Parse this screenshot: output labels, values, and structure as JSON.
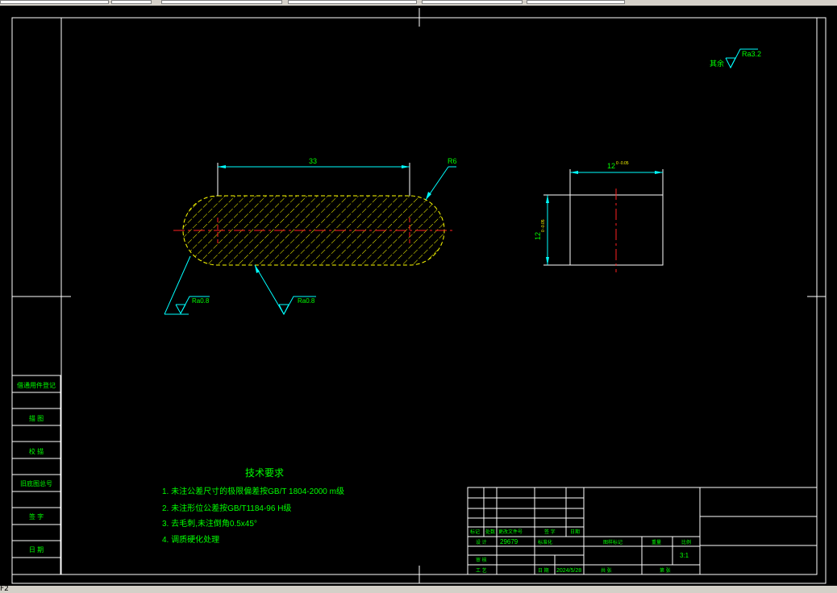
{
  "status_text": "F2",
  "drawing": {
    "surface_finish_general": {
      "prefix": "其余",
      "value": "Ra3.2"
    },
    "dim_length": "33",
    "dim_radius": "R6",
    "dim_width": "12",
    "dim_width_tol": "0\n-0.05",
    "dim_height": "12",
    "dim_height_tol": "0\n-0.05",
    "roughness_left": "Ra0.8",
    "roughness_bottom": "Ra0.8",
    "tech_title": "技术要求",
    "tech_notes": [
      "1. 未注公差尺寸的极限偏差按GB/T 1804-2000 m级",
      "2. 未注形位公差按GB/T1184-96 H级",
      "3. 去毛刺,未注倒角0.5x45°",
      "4. 调质硬化处理"
    ]
  },
  "side_column": [
    "借通用件登记",
    "描 图",
    "校 描",
    "旧底图总号",
    "签 字",
    "日 期"
  ],
  "title_block": {
    "row_labels": [
      "标记",
      "处数",
      "更改文件号",
      "签 字",
      "日期"
    ],
    "design_label": "设 计",
    "design_value": "29679",
    "std_label": "标准化",
    "review_label": "审 核",
    "process_label": "工 艺",
    "date_label": "日 期",
    "date_value": "2024/5/28",
    "stage_label": "图样标记",
    "weight_label": "重量",
    "scale_label": "比例",
    "scale_value": "3:1",
    "sheet_total_label": "共  张",
    "sheet_label": "第  张"
  }
}
